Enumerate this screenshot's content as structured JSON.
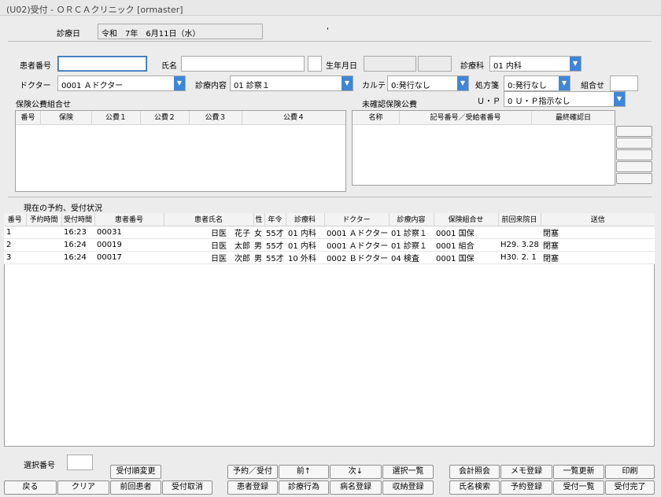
{
  "window": {
    "title": "(U02)受付 - ＯＲＣＡクリニック [ormaster]"
  },
  "date": {
    "label": "診療日",
    "value": "令和　7年　6月11日（水）",
    "mark": "'"
  },
  "patient": {
    "id_label": "患者番号",
    "id_value": "",
    "name_label": "氏名",
    "name_value": "",
    "birth_label": "生年月日"
  },
  "dept": {
    "label": "診療科",
    "value": "01 内科"
  },
  "doctor": {
    "label": "ドクター",
    "value": "0001 Ａドクター"
  },
  "content": {
    "label": "診療内容",
    "value": "01 診察１"
  },
  "karte": {
    "label": "カルテ",
    "value": "0:発行なし"
  },
  "rx": {
    "label": "処方箋",
    "value": "0:発行なし"
  },
  "combo": {
    "label": "組合せ",
    "value": ""
  },
  "up": {
    "label": "Ｕ・Ｐ",
    "value": "0 Ｕ・Ｐ指示なし"
  },
  "insurance": {
    "label": "保険公費組合せ",
    "headers": [
      "番号",
      "保険",
      "公費１",
      "公費２",
      "公費３",
      "公費４"
    ]
  },
  "unconfirmed": {
    "label": "未確認保険公費",
    "headers": [
      "名称",
      "記号番号／受給者番号",
      "最終確認日"
    ]
  },
  "status_label": "現在の予約、受付状況",
  "grid": {
    "headers": [
      "番号",
      "予約時間",
      "受付時間",
      "患者番号",
      "患者氏名",
      "性",
      "年令",
      "診療科",
      "ドクター",
      "診療内容",
      "保険組合せ",
      "前回来院日",
      "送信"
    ],
    "rows": [
      [
        "1",
        "",
        "16:23",
        "00031",
        "日医　花子",
        "女",
        "55才",
        "01 内科",
        "0001 Ａドクター",
        "01 診察１",
        "0001 国保",
        "",
        "閉塞"
      ],
      [
        "2",
        "",
        "16:24",
        "00019",
        "日医　太郎",
        "男",
        "55才",
        "01 内科",
        "0001 Ａドクター",
        "01 診察１",
        "0001 組合",
        "H29. 3.28",
        "閉塞"
      ],
      [
        "3",
        "",
        "16:24",
        "00017",
        "日医　次郎",
        "男",
        "55才",
        "10 外科",
        "0002 Ｂドクター",
        "04 検査",
        "0001 国保",
        "H30. 2. 1",
        "閉塞"
      ]
    ]
  },
  "select_label": "選択番号",
  "buttons": {
    "back": "戻る",
    "clear": "クリア",
    "order_change": "受付順変更",
    "prev_patient": "前回患者",
    "cancel": "受付取消",
    "reserve": "予約／受付",
    "prev": "前↑",
    "next": "次↓",
    "select_list": "選択一覧",
    "patient_reg": "患者登録",
    "procedure": "診療行為",
    "disease": "病名登録",
    "receipt": "収納登録",
    "account": "会計照会",
    "memo": "メモ登録",
    "refresh": "一覧更新",
    "print": "印刷",
    "name_search": "氏名検索",
    "reserve_reg": "予約登録",
    "list": "受付一覧",
    "complete": "受付完了"
  }
}
